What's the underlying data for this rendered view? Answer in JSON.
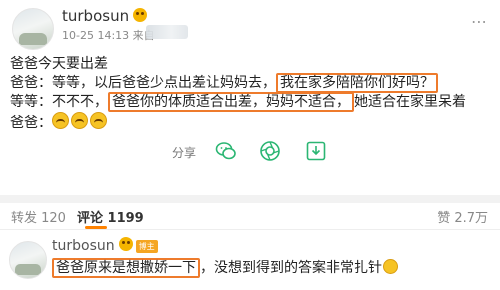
{
  "post": {
    "username": "turbosun",
    "timestamp": "10-25 14:13 来自",
    "lines": {
      "l1": "爸爸今天要出差",
      "l2a": "爸爸：等等，以后爸爸少点出差让妈妈去，",
      "l2b": "我在家多陪陪你们好吗？",
      "l3a": "等等：不不不，",
      "l3b": "爸爸你的体质适合出差，妈妈不适合，",
      "l3c": "她适合在家里呆着",
      "l4": "爸爸："
    },
    "actions": {
      "share_label": "分享"
    }
  },
  "tabs": {
    "repost": "转发 120",
    "comment": "评论 1199",
    "like": "赞 2.7万"
  },
  "comment": {
    "username": "turbosun",
    "badge": "博主",
    "text_hl": "爸爸原来是想撒娇一下",
    "text_rest": "，没想到得到的答案非常扎针"
  },
  "colors": {
    "highlight_box": "#ee7b2c",
    "tab_accent": "#ff8200",
    "share_green": "#2bb673"
  }
}
